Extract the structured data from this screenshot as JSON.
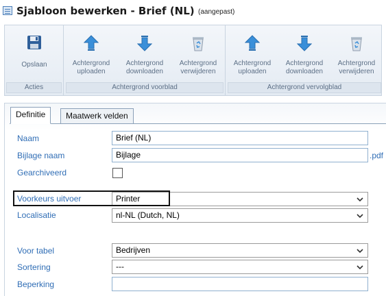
{
  "window": {
    "title": "Sjabloon bewerken - Brief (NL)",
    "subtitle": "(aangepast)"
  },
  "ribbon": {
    "groups": [
      {
        "label": "Acties",
        "buttons": [
          {
            "label": "Opslaan",
            "icon": "save-icon"
          }
        ]
      },
      {
        "label": "Achtergrond voorblad",
        "buttons": [
          {
            "label": "Achtergrond uploaden",
            "icon": "upload-arrow-icon"
          },
          {
            "label": "Achtergrond downloaden",
            "icon": "download-arrow-icon"
          },
          {
            "label": "Achtergrond verwijderen",
            "icon": "recycle-bin-icon"
          }
        ]
      },
      {
        "label": "Achtergrond vervolgblad",
        "buttons": [
          {
            "label": "Achtergrond uploaden",
            "icon": "upload-arrow-icon"
          },
          {
            "label": "Achtergrond downloaden",
            "icon": "download-arrow-icon"
          },
          {
            "label": "Achtergrond verwijderen",
            "icon": "recycle-bin-icon"
          }
        ]
      }
    ]
  },
  "tabs": [
    {
      "label": "Definitie",
      "active": true
    },
    {
      "label": "Maatwerk velden",
      "active": false
    }
  ],
  "form": {
    "naam": {
      "label": "Naam",
      "value": "Brief (NL)"
    },
    "bijlage_naam": {
      "label": "Bijlage naam",
      "value": "Bijlage",
      "suffix": ".pdf"
    },
    "gearchiveerd": {
      "label": "Gearchiveerd",
      "checked": false
    },
    "voorkeurs_uitvoer": {
      "label": "Voorkeurs uitvoer",
      "value": "Printer"
    },
    "localisatie": {
      "label": "Localisatie",
      "value": "nl-NL (Dutch, NL)"
    },
    "voor_tabel": {
      "label": "Voor tabel",
      "value": "Bedrijven"
    },
    "sortering": {
      "label": "Sortering",
      "value": "---"
    },
    "beperking": {
      "label": "Beperking",
      "value": ""
    }
  },
  "colors": {
    "label_blue": "#2f6db5",
    "ribbon_text": "#5c6f86",
    "arrow_blue": "#3a8fd9"
  }
}
